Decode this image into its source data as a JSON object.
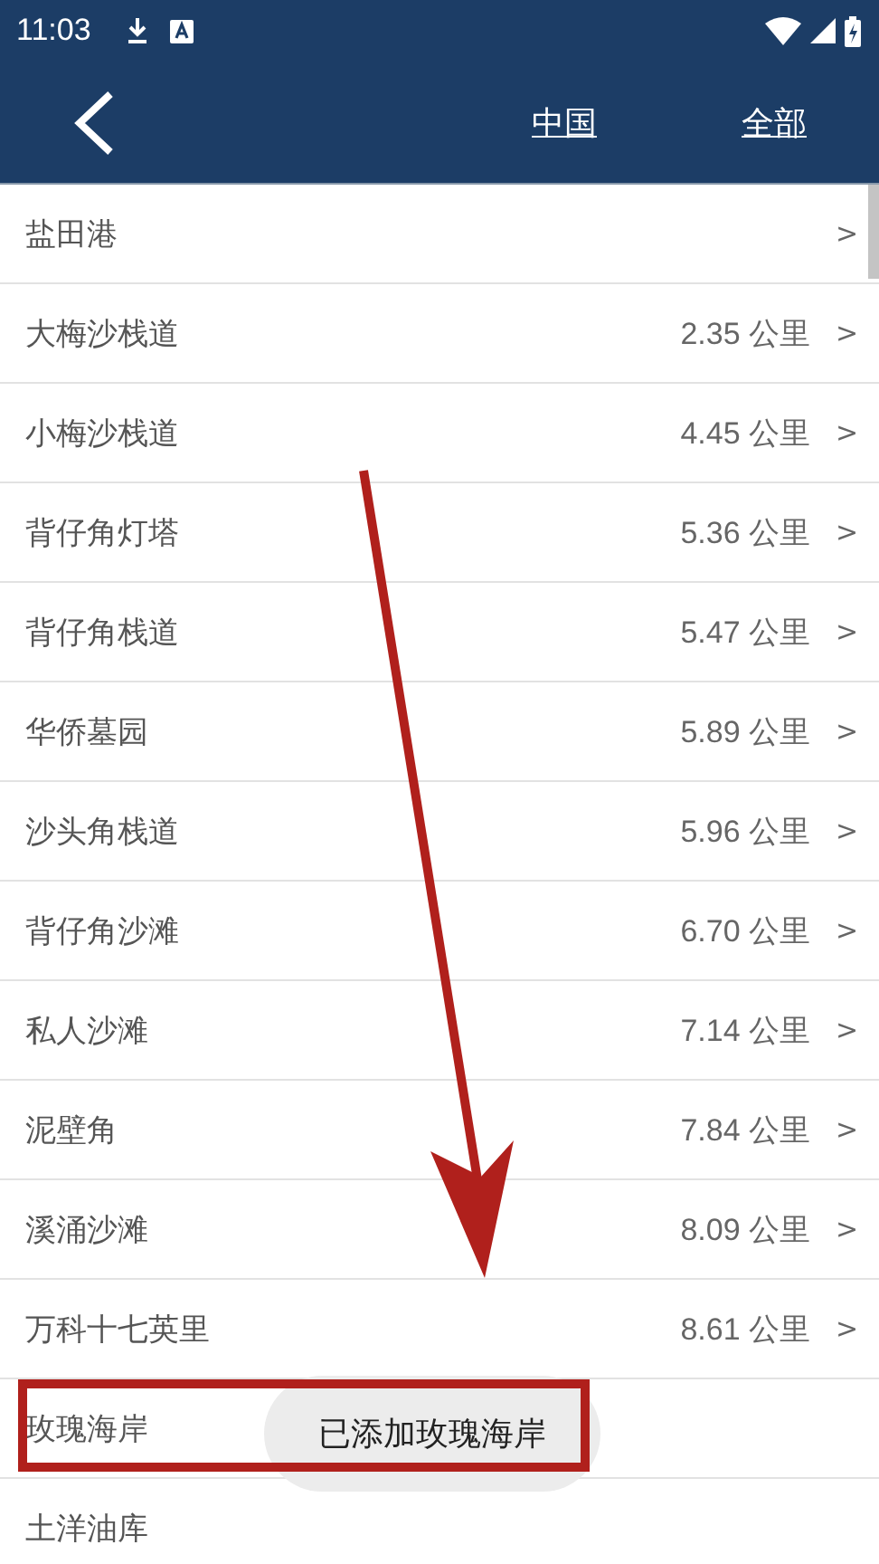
{
  "status_bar": {
    "time": "11:03"
  },
  "app_bar": {
    "actions": [
      "中国",
      "全部"
    ]
  },
  "list": [
    {
      "name": "盐田港",
      "chevron": ">"
    },
    {
      "name": "大梅沙栈道",
      "distance": "2.35 公里",
      "chevron": ">"
    },
    {
      "name": "小梅沙栈道",
      "distance": "4.45 公里",
      "chevron": ">"
    },
    {
      "name": "背仔角灯塔",
      "distance": "5.36 公里",
      "chevron": ">"
    },
    {
      "name": "背仔角栈道",
      "distance": "5.47 公里",
      "chevron": ">"
    },
    {
      "name": "华侨墓园",
      "distance": "5.89 公里",
      "chevron": ">"
    },
    {
      "name": "沙头角栈道",
      "distance": "5.96 公里",
      "chevron": ">"
    },
    {
      "name": "背仔角沙滩",
      "distance": "6.70 公里",
      "chevron": ">"
    },
    {
      "name": "私人沙滩",
      "distance": "7.14 公里",
      "chevron": ">"
    },
    {
      "name": "泥壁角",
      "distance": "7.84 公里",
      "chevron": ">"
    },
    {
      "name": "溪涌沙滩",
      "distance": "8.09 公里",
      "chevron": ">"
    },
    {
      "name": "万科十七英里",
      "distance": "8.61 公里",
      "chevron": ">"
    },
    {
      "name": "玫瑰海岸"
    },
    {
      "name": "土洋油库"
    }
  ],
  "toast": {
    "text": "已添加玫瑰海岸"
  },
  "annotations": {
    "arrow": true,
    "highlight_box": true
  }
}
